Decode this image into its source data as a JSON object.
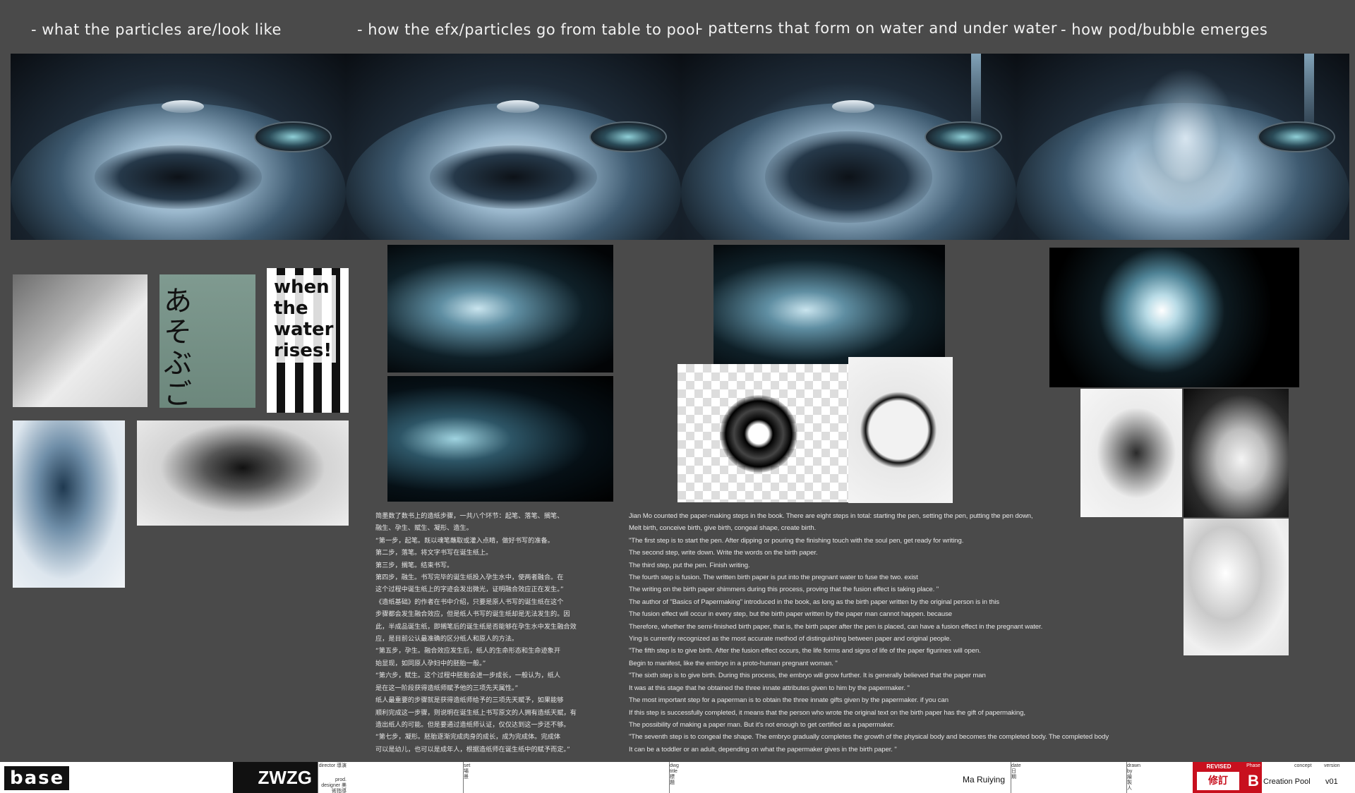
{
  "headings": [
    "- what the particles are/look like",
    "- how the efx/particles go from table to pool",
    "- patterns that form on water and under water",
    "- how pod/bubble emerges"
  ],
  "posters": {
    "green_vertical": "あそぶ ごわんなさい",
    "bw_lines": [
      "when",
      "the",
      "water",
      "rises!"
    ]
  },
  "chinese_text": [
    "简墨数了数书上的造纸步骤，一共八个环节：起笔、落笔、搁笔、",
    "融生、孕生、赋生、凝形、造生。",
    "“第一步，起笔。既以魂笔蘸取或灌入点睛，做好书写的准备。",
    "第二步，落笔。将文字书写在诞生纸上。",
    "第三步，搁笔。结束书写。",
    "第四步，融生。书写完毕的诞生纸投入孕生水中，使两者融合。在",
    "这个过程中诞生纸上的字迹会发出微光，证明融合效应正在发生。”",
    "《造纸基础》的作者在书中介绍，只要是原人书写的诞生纸在这个",
    "步骤都会发生融合效应，但是纸人书写的诞生纸却是无法发生的。因",
    "此，半成品诞生纸，即搁笔后的诞生纸是否能够在孕生水中发生融合效",
    "应，是目前公认最准确的区分纸人和原人的方法。",
    "“第五步，孕生。融合效应发生后，纸人的生命形态和生命迹象开",
    "始显现，如同原人孕妇中的胚胎一般。”",
    "“第六步，赋生。这个过程中胚胎会进一步成长，一般认为，纸人",
    "是在这一阶段获得造纸师赋予他的三项先天属性。”",
    "纸人最重要的步骤就是获得造纸师给予的三项先天赋予，如果能够",
    "顺利完成这一步骤，则说明在诞生纸上书写原文的人拥有造纸天赋，有",
    "造出纸人的可能。但是要通过造纸师认证，仅仅达到这一步还不够。",
    "“第七步，凝形。胚胎逐渐完成肉身的成长，成为完成体。完成体",
    "可以是幼儿，也可以是成年人，根据造纸师在诞生纸中的赋予而定。”"
  ],
  "english_text": [
    "Jian Mo counted the paper-making steps in the book. There are eight steps in total: starting the pen, setting the pen, putting the pen down,",
    "Melt birth, conceive birth, give birth, congeal shape, create birth.",
    "\"The first step is to start the pen. After dipping or pouring the finishing touch with the soul pen, get ready for writing.",
    "The second step, write down. Write the words on the birth paper.",
    "The third step, put the pen. Finish writing.",
    "The fourth step is fusion. The written birth paper is put into the pregnant water to fuse the two. exist",
    "The writing on the birth paper shimmers during this process, proving that the fusion effect is taking place. \"",
    "The author of \"Basics of Papermaking\" introduced in the book, as long as the birth paper written by the original person is in this",
    "The fusion effect will occur in every step, but the birth paper written by the paper man cannot happen. because",
    "Therefore, whether the semi-finished birth paper, that is, the birth paper after the pen is placed, can have a fusion effect in the pregnant water.",
    "Ying is currently recognized as the most accurate method of distinguishing between paper and original people.",
    "\"The fifth step is to give birth. After the fusion effect occurs, the life forms and signs of life of the paper figurines will open.",
    "Begin to manifest, like the embryo in a proto-human pregnant woman. \"",
    "\"The sixth step is to give birth. During this process, the embryo will grow further. It is generally believed that the paper man",
    "It was at this stage that he obtained the three innate attributes given to him by the papermaker. \"",
    "The most important step for a paperman is to obtain the three innate gifts given by the papermaker. if you can",
    "If this step is successfully completed, it means that the person who wrote the original text on the birth paper has the gift of papermaking,",
    "The possibility of making a paper man. But it's not enough to get certified as a papermaker.",
    "\"The seventh step is to congeal the shape. The embryo gradually completes the growth of the physical body and becomes the completed body. The completed body",
    "It can be a toddler or an adult, depending on what the papermaker gives in the birth paper. \""
  ],
  "footer": {
    "logo": "base",
    "client": "ZWZG",
    "director_label": "director 導演",
    "prod_designer_label": "prod. designer 美術指導",
    "set_label": "set 場景",
    "dwg_title_label": "dwg title 標題",
    "date_label": "date 日期",
    "drawn_by_label": "drawn by 繪製人",
    "drawn_by_value": "Ma Ruiying",
    "revised_label": "REVISED",
    "revised_value": "修訂",
    "phase_label": "Phase",
    "phase_value": "B",
    "concept_label": "concept",
    "concept_value": "Creation Pool",
    "version_label": "version",
    "version_value": "v01"
  }
}
